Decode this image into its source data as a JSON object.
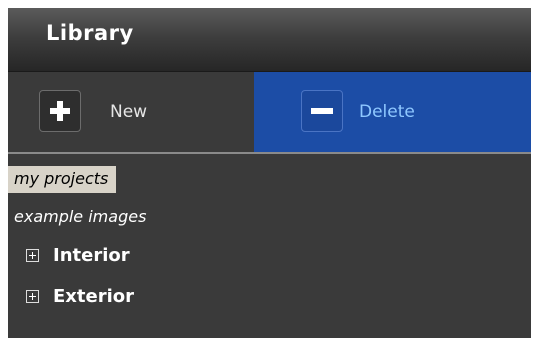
{
  "header": {
    "title": "Library"
  },
  "toolbar": {
    "new_label": "New",
    "new_icon": "plus-icon",
    "delete_label": "Delete",
    "delete_icon": "minus-icon",
    "delete_active_color": "#1c4da6"
  },
  "tree": {
    "items": [
      {
        "label": "my projects",
        "selected": true
      },
      {
        "label": "example images",
        "selected": false
      },
      {
        "label": "Interior",
        "expandable": true,
        "expander_icon": "expand-plus-icon"
      },
      {
        "label": "Exterior",
        "expandable": true,
        "expander_icon": "expand-plus-icon"
      }
    ]
  }
}
